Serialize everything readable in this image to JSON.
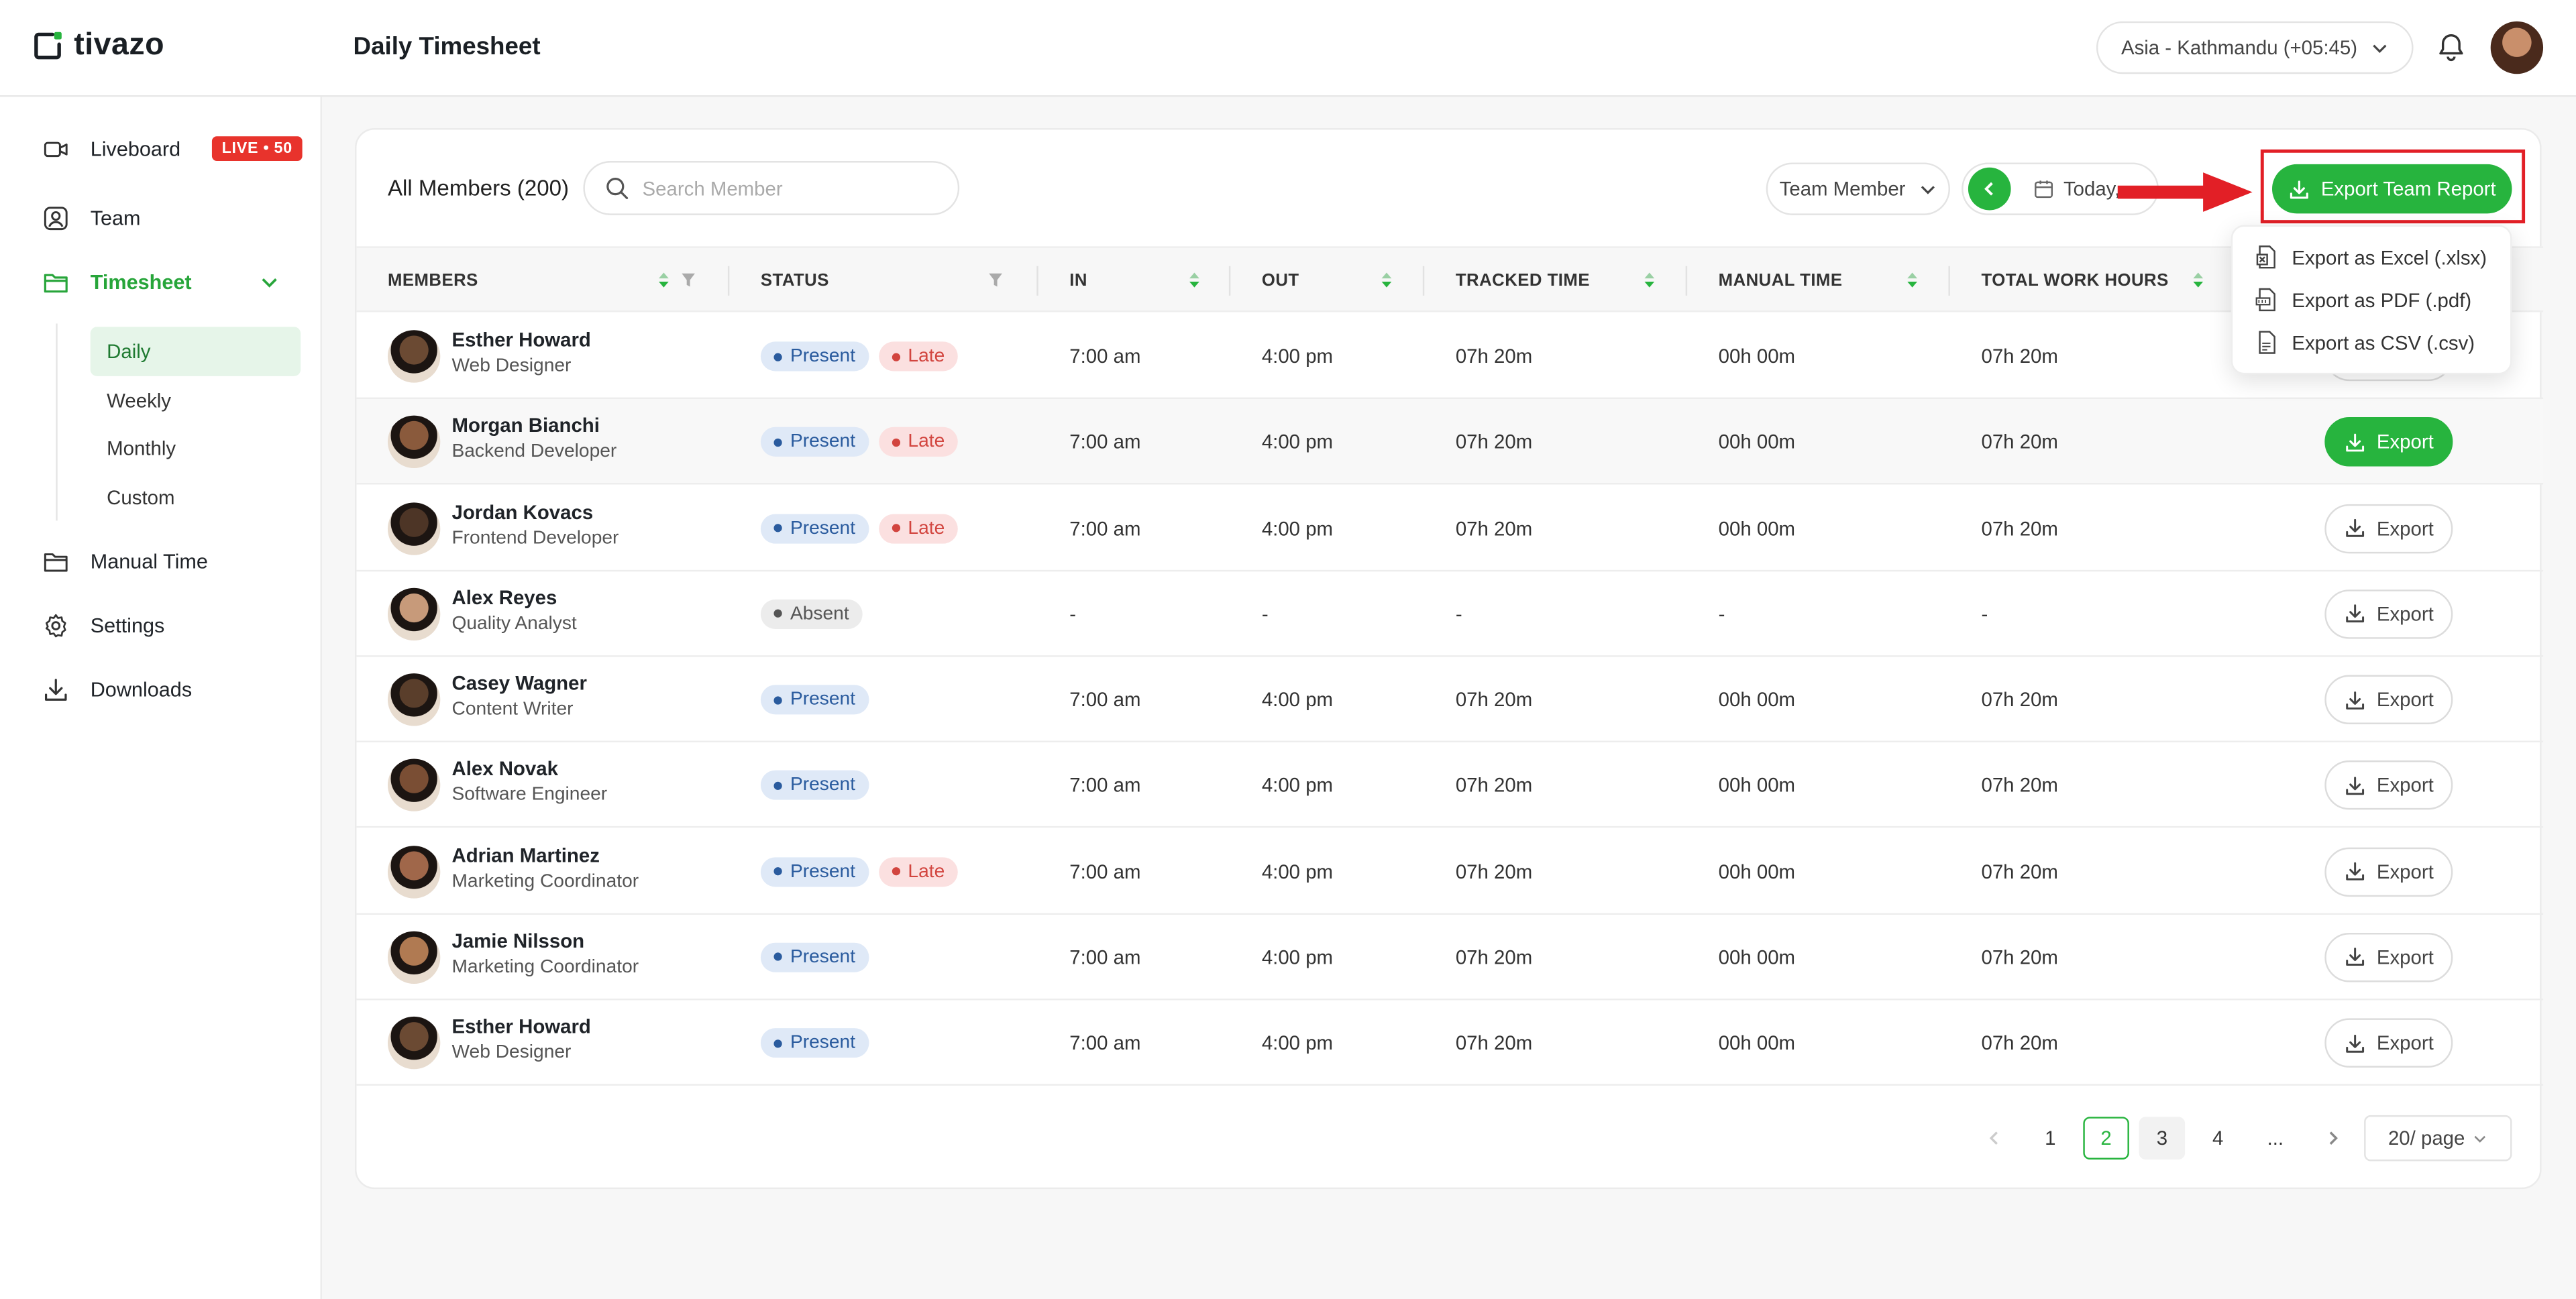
{
  "app": {
    "name": "tivazo",
    "page_title": "Daily Timesheet"
  },
  "header": {
    "timezone": "Asia - Kathmandu (+05:45)"
  },
  "sidebar": {
    "items": [
      {
        "label": "Liveboard",
        "badge": "LIVE • 50"
      },
      {
        "label": "Team"
      },
      {
        "label": "Timesheet"
      },
      {
        "label": "Manual Time"
      },
      {
        "label": "Settings"
      },
      {
        "label": "Downloads"
      }
    ],
    "sub_items": [
      {
        "label": "Daily"
      },
      {
        "label": "Weekly"
      },
      {
        "label": "Monthly"
      },
      {
        "label": "Custom"
      }
    ]
  },
  "toolbar": {
    "title": "All Members (200)",
    "search_placeholder": "Search Member",
    "team_select": "Team Member",
    "date": "Today,",
    "export_team": "Export Team Report"
  },
  "export_menu": {
    "items": [
      {
        "label": "Export as Excel (.xlsx)"
      },
      {
        "label": "Export as PDF (.pdf)"
      },
      {
        "label": "Export as CSV (.csv)"
      }
    ]
  },
  "table": {
    "columns": [
      "MEMBERS",
      "STATUS",
      "IN",
      "OUT",
      "TRACKED TIME",
      "MANUAL TIME",
      "TOTAL WORK HOURS"
    ],
    "export_label": "Export",
    "present_label": "Present",
    "late_label": "Late",
    "absent_label": "Absent",
    "rows": [
      {
        "name": "Esther Howard",
        "role": "Web Designer",
        "present": true,
        "late": true,
        "in": "7:00 am",
        "out": "4:00 pm",
        "tracked": "07h 20m",
        "manual": "00h 00m",
        "total": "07h 20m"
      },
      {
        "name": "Morgan Bianchi",
        "role": "Backend Developer",
        "present": true,
        "late": true,
        "in": "7:00 am",
        "out": "4:00 pm",
        "tracked": "07h 20m",
        "manual": "00h 00m",
        "total": "07h 20m"
      },
      {
        "name": "Jordan Kovacs",
        "role": "Frontend Developer",
        "present": true,
        "late": true,
        "in": "7:00 am",
        "out": "4:00 pm",
        "tracked": "07h 20m",
        "manual": "00h 00m",
        "total": "07h 20m"
      },
      {
        "name": "Alex Reyes",
        "role": "Quality Analyst",
        "present": false,
        "late": false,
        "in": "-",
        "out": "-",
        "tracked": "-",
        "manual": "-",
        "total": "-"
      },
      {
        "name": "Casey Wagner",
        "role": "Content Writer",
        "present": true,
        "late": false,
        "in": "7:00 am",
        "out": "4:00 pm",
        "tracked": "07h 20m",
        "manual": "00h 00m",
        "total": "07h 20m"
      },
      {
        "name": "Alex Novak",
        "role": "Software Engineer",
        "present": true,
        "late": false,
        "in": "7:00 am",
        "out": "4:00 pm",
        "tracked": "07h 20m",
        "manual": "00h 00m",
        "total": "07h 20m"
      },
      {
        "name": "Adrian Martinez",
        "role": "Marketing Coordinator",
        "present": true,
        "late": true,
        "in": "7:00 am",
        "out": "4:00 pm",
        "tracked": "07h 20m",
        "manual": "00h 00m",
        "total": "07h 20m"
      },
      {
        "name": "Jamie Nilsson",
        "role": "Marketing Coordinator",
        "present": true,
        "late": false,
        "in": "7:00 am",
        "out": "4:00 pm",
        "tracked": "07h 20m",
        "manual": "00h 00m",
        "total": "07h 20m"
      },
      {
        "name": "Esther Howard",
        "role": "Web Designer",
        "present": true,
        "late": false,
        "in": "7:00 am",
        "out": "4:00 pm",
        "tracked": "07h 20m",
        "manual": "00h 00m",
        "total": "07h 20m"
      }
    ]
  },
  "pagination": {
    "pages": [
      "1",
      "2",
      "3",
      "4",
      "..."
    ],
    "current": "2",
    "per_page": "20/ page"
  },
  "colors": {
    "brand_green": "#27b43e",
    "live_red": "#e8332c",
    "highlight_red": "#e21f26"
  }
}
